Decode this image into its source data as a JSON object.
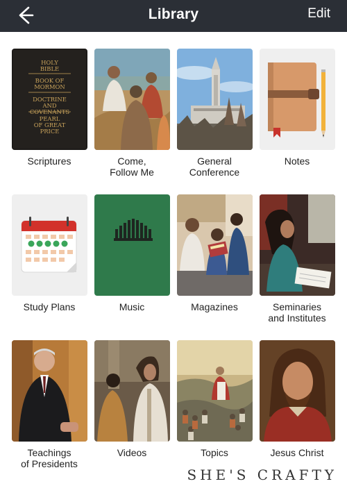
{
  "header": {
    "title": "Library",
    "edit_label": "Edit"
  },
  "tiles": [
    {
      "label": "Scriptures",
      "cover_lines": [
        "HOLY",
        "BIBLE",
        "BOOK OF",
        "MORMON",
        "DOCTRINE",
        "AND",
        "COVENANTS",
        "PEARL",
        "OF GREAT",
        "PRICE"
      ]
    },
    {
      "label": "Come,\nFollow Me"
    },
    {
      "label": "General\nConference"
    },
    {
      "label": "Notes"
    },
    {
      "label": "Study Plans"
    },
    {
      "label": "Music"
    },
    {
      "label": "Magazines"
    },
    {
      "label": "Seminaries\nand Institutes"
    },
    {
      "label": "Teachings\nof Presidents"
    },
    {
      "label": "Videos"
    },
    {
      "label": "Topics"
    },
    {
      "label": "Jesus Christ"
    }
  ],
  "watermark": "SHE'S CRAFTY",
  "colors": {
    "header_bg": "#2b2f36",
    "scripture_cover": "#1d1b19",
    "scripture_gold": "#c9a35b",
    "music_green": "#2f7a4b",
    "calendar_red": "#d2312b",
    "check_green": "#3aa65a"
  },
  "icons": [
    "back-arrow-icon",
    "notebook-icon",
    "pencil-icon",
    "calendar-icon",
    "organ-pipes-icon"
  ]
}
